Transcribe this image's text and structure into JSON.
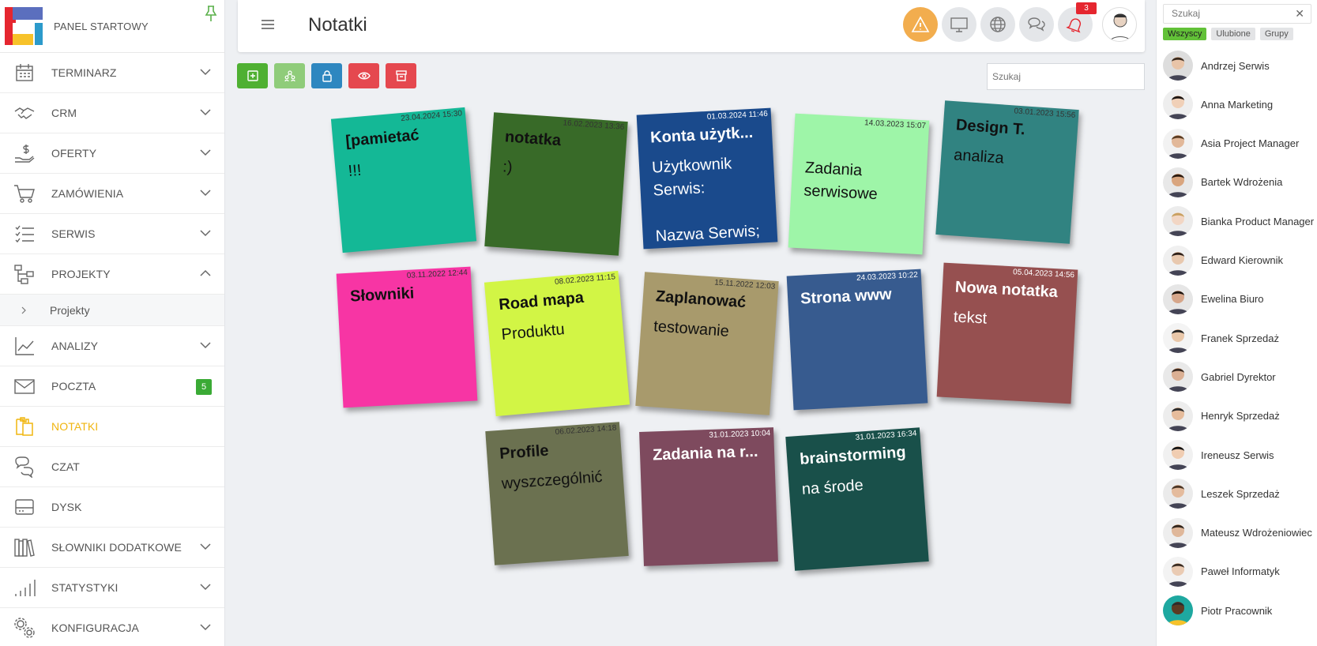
{
  "brand": {
    "title": "PANEL STARTOWY"
  },
  "colors": {
    "accent": "#f0b50f",
    "success": "#3aaa35",
    "danger": "#e5262f",
    "warning": "#f2ad4e"
  },
  "sidebar": {
    "items": [
      {
        "label": "TERMINARZ",
        "icon": "calendar-icon",
        "expandable": true
      },
      {
        "label": "CRM",
        "icon": "handshake-icon",
        "expandable": true
      },
      {
        "label": "OFERTY",
        "icon": "dollar-hand-icon",
        "expandable": true
      },
      {
        "label": "ZAMÓWIENIA",
        "icon": "cart-icon",
        "expandable": true
      },
      {
        "label": "SERWIS",
        "icon": "checklist-icon",
        "expandable": true
      },
      {
        "label": "PROJEKTY",
        "icon": "project-tree-icon",
        "expandable": true,
        "expanded": true
      },
      {
        "label": "ANALIZY",
        "icon": "chart-line-icon",
        "expandable": true
      },
      {
        "label": "POCZTA",
        "icon": "envelope-icon",
        "badge": "5"
      },
      {
        "label": "NOTATKI",
        "icon": "notes-icon",
        "active": true
      },
      {
        "label": "CZAT",
        "icon": "chat-icon"
      },
      {
        "label": "DYSK",
        "icon": "drive-icon"
      },
      {
        "label": "SŁOWNIKI DODATKOWE",
        "icon": "books-icon",
        "expandable": true
      },
      {
        "label": "STATYSTYKI",
        "icon": "bars-icon",
        "expandable": true
      },
      {
        "label": "KONFIGURACJA",
        "icon": "gears-icon",
        "expandable": true
      }
    ],
    "sub_item": "Projekty"
  },
  "header": {
    "title": "Notatki",
    "notification_count": "3"
  },
  "toolbar": {
    "search_placeholder": "Szukaj"
  },
  "notes": [
    {
      "title": "[pamietać",
      "date": "23.04.2024 15:30",
      "body": "!!!",
      "color": "#14b896"
    },
    {
      "title": "notatka",
      "date": "16.02.2023 13:36",
      "body": ":)",
      "color": "#386a28"
    },
    {
      "title": "Konta użytk...",
      "date": "01.03.2024 11:46",
      "body": "Użytkownik\nSerwis:\n\nNazwa Serwis;",
      "color": "#1a4a8c"
    },
    {
      "title": "",
      "date": "14.03.2023 15:07",
      "body": "Zadania\nserwisowe",
      "color": "#9ef5a8"
    },
    {
      "title": "Design T.",
      "date": "03.01.2023 15:56",
      "body": "analiza",
      "color": "#318381"
    },
    {
      "title": "Słowniki",
      "date": "03.11.2022 12:44",
      "body": "",
      "color": "#f735a4"
    },
    {
      "title": "Road mapa",
      "date": "08.02.2023 11:15",
      "body": "Produktu",
      "color": "#d2f545"
    },
    {
      "title": "Zaplanować",
      "date": "15.11.2022 12:03",
      "body": "testowanie",
      "color": "#a89a6c"
    },
    {
      "title": "Strona www",
      "date": "24.03.2023 10:22",
      "body": "",
      "color": "#375b8f"
    },
    {
      "title": "Nowa notatka",
      "date": "05.04.2023 14:56",
      "body": "tekst",
      "color": "#965050"
    },
    {
      "title": "Profile",
      "date": "06.02.2023 14:18",
      "body": "wyszczególnić",
      "color": "#6b7150"
    },
    {
      "title": "Zadania na r...",
      "date": "31.01.2023 10:04",
      "body": "",
      "color": "#7e4a5e"
    },
    {
      "title": "brainstorming",
      "date": "31.01.2023 16:34",
      "body": "na środe",
      "color": "#19504a"
    }
  ],
  "right_panel": {
    "search_placeholder": "Szukaj",
    "filters": [
      "Wszyscy",
      "Ulubione",
      "Grupy"
    ],
    "users": [
      "Andrzej Serwis",
      "Anna Marketing",
      "Asia Project Manager",
      "Bartek Wdrożenia",
      "Bianka Product Manager",
      "Edward Kierownik",
      "Ewelina Biuro",
      "Franek Sprzedaż",
      "Gabriel Dyrektor",
      "Henryk Sprzedaż",
      "Ireneusz Serwis",
      "Leszek Sprzedaż",
      "Mateusz Wdrożeniowiec",
      "Paweł Informatyk",
      "Piotr Pracownik"
    ]
  }
}
